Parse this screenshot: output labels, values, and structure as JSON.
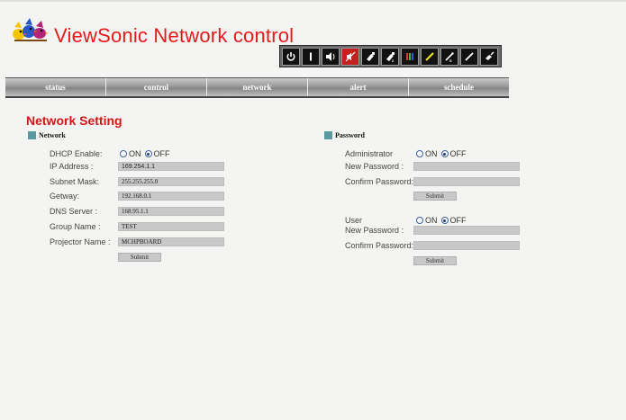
{
  "header": {
    "brand_title": "ViewSonic Network control",
    "logo_icon": "viewsonic-birds-logo"
  },
  "toolbar": {
    "icons": [
      "power-icon",
      "input-icon",
      "volume-icon",
      "mute-icon",
      "vga-icon",
      "vga2-icon",
      "component-icon",
      "svideo-icon",
      "video-icon",
      "composite-icon",
      "hdmi-icon"
    ]
  },
  "nav": {
    "items": [
      "status",
      "control",
      "network",
      "alert",
      "schedule"
    ]
  },
  "page": {
    "title": "Network Setting"
  },
  "network": {
    "heading": "Network",
    "dhcp_label": "DHCP Enable:",
    "on_label": "ON",
    "off_label": "OFF",
    "dhcp_selected": "OFF",
    "ip_label": "IP Address :",
    "ip_value": "169.254.1.1",
    "subnet_label": "Subnet Mask:",
    "subnet_value": "255.255.255.0",
    "gateway_label": "Getway:",
    "gateway_value": "192.168.0.1",
    "dns_label": "DNS Server :",
    "dns_value": "168.95.1.1",
    "group_label": "Group Name :",
    "group_value": "TEST",
    "projector_label": "Projector Name :",
    "projector_value": "MCHPBOARD",
    "submit_label": "Submit"
  },
  "password": {
    "heading": "Password",
    "admin_label": "Administrator",
    "on_label": "ON",
    "off_label": "OFF",
    "admin_selected": "OFF",
    "admin_new_label": "New Password :",
    "admin_confirm_label": "Confirm Password:",
    "admin_submit": "Submit",
    "user_label": "User",
    "user_selected": "OFF",
    "user_new_label": "New Password :",
    "user_confirm_label": "Confirm Password:",
    "user_submit": "Submit"
  },
  "colors": {
    "brand_red": "#e51a1a",
    "section_square": "#5b9aa0",
    "field_gray": "#c8c8c8"
  }
}
